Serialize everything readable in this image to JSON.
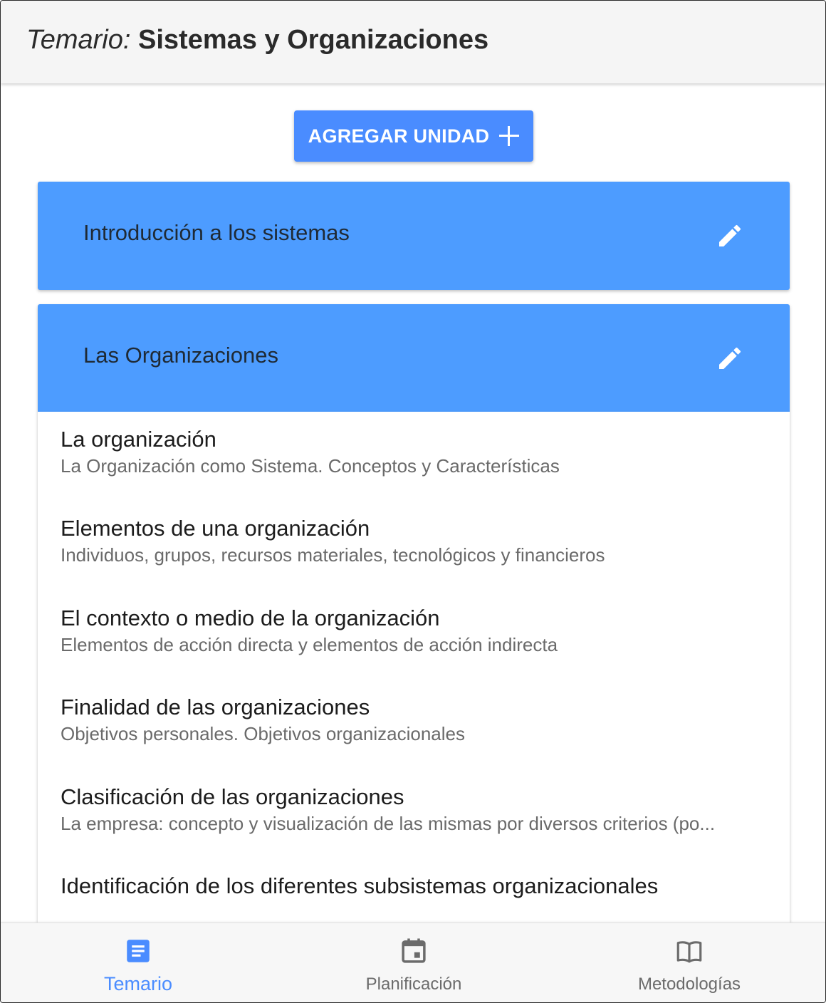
{
  "header": {
    "title_prefix": "Temario:",
    "title_name": "Sistemas y Organizaciones"
  },
  "add_button": {
    "label": "AGREGAR UNIDAD",
    "icon": "plus-icon"
  },
  "units": [
    {
      "title": "Introducción a los sistemas",
      "edit_icon": "pencil-icon"
    },
    {
      "title": "Las Organizaciones",
      "edit_icon": "pencil-icon"
    }
  ],
  "topics": [
    {
      "title": "La organización",
      "subtitle": "La Organización como Sistema. Conceptos y Características"
    },
    {
      "title": "Elementos de una organización",
      "subtitle": "Individuos, grupos, recursos materiales, tecnológicos y financieros"
    },
    {
      "title": "El contexto o medio de la organización",
      "subtitle": "Elementos de acción directa y elementos de acción indirecta"
    },
    {
      "title": "Finalidad de las organizaciones",
      "subtitle": "Objetivos personales. Objetivos organizacionales"
    },
    {
      "title": "Clasificación de las organizaciones",
      "subtitle": "La empresa: concepto y visualización de las mismas por diversos criterios (po..."
    },
    {
      "title": "Identificación de los diferentes subsistemas organizacionales",
      "subtitle": ""
    }
  ],
  "bottom_nav": [
    {
      "label": "Temario",
      "icon": "document-icon",
      "active": true
    },
    {
      "label": "Planificación",
      "icon": "calendar-icon",
      "active": false
    },
    {
      "label": "Metodologías",
      "icon": "book-icon",
      "active": false
    }
  ],
  "colors": {
    "accent": "#4a8cff",
    "unit_header": "#4d9cff",
    "appbar": "#f5f5f5",
    "inactive": "#6b6b6b"
  }
}
